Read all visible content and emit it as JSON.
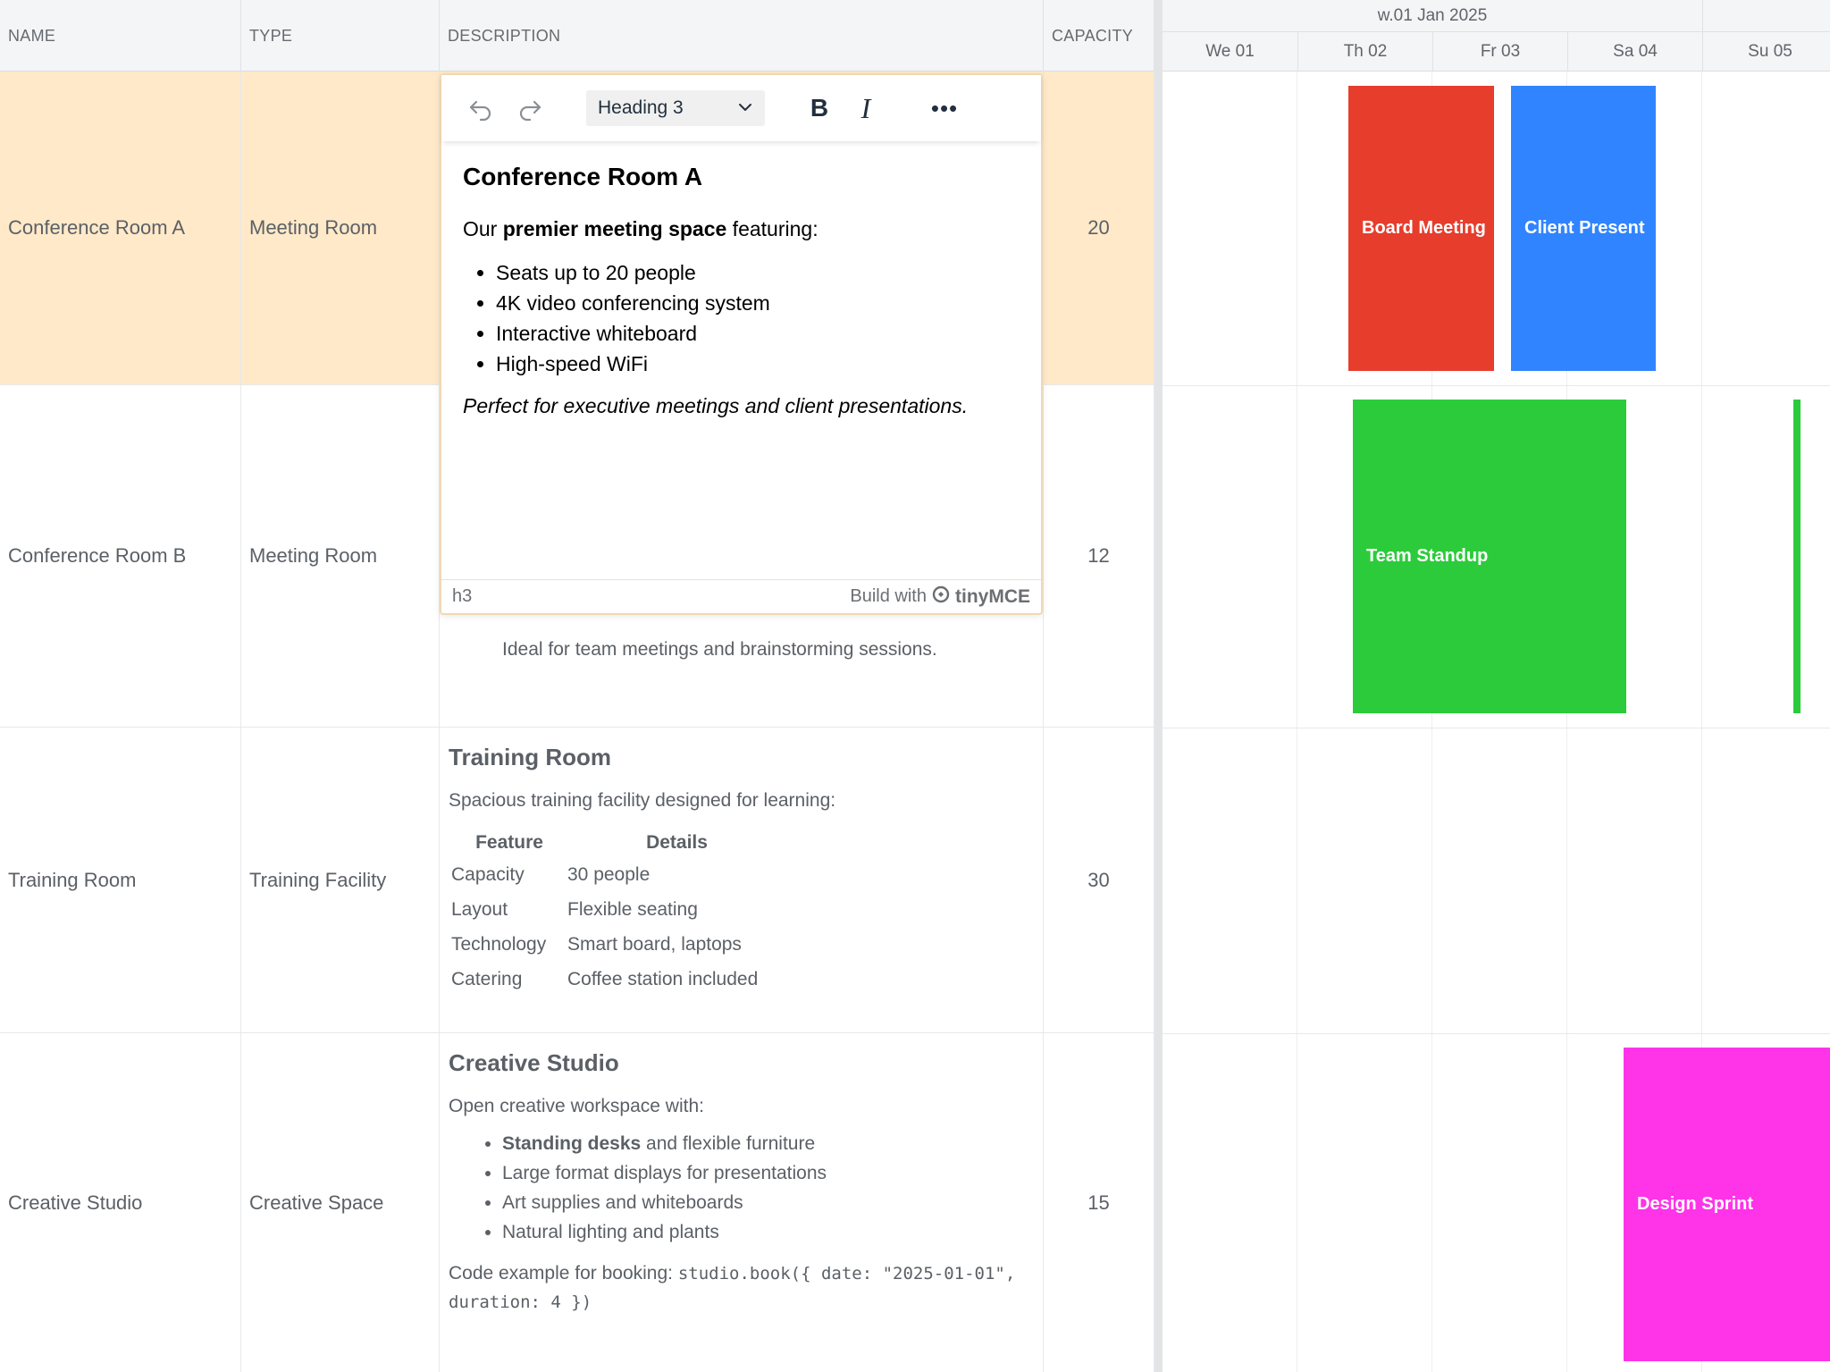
{
  "columns": {
    "name": "NAME",
    "type": "TYPE",
    "description": "DESCRIPTION",
    "capacity": "CAPACITY"
  },
  "timeline": {
    "week_label": "w.01 Jan 2025",
    "days": [
      "We 01",
      "Th 02",
      "Fr 03",
      "Sa 04",
      "Su 05"
    ]
  },
  "rows": [
    {
      "name": "Conference Room A",
      "type": "Meeting Room",
      "capacity": "20"
    },
    {
      "name": "Conference Room B",
      "type": "Meeting Room",
      "capacity": "12",
      "description_tail": "Ideal for team meetings and brainstorming sessions."
    },
    {
      "name": "Training Room",
      "type": "Training Facility",
      "capacity": "30",
      "desc_title": "Training Room",
      "desc_intro": "Spacious training facility designed for learning:",
      "table_headers": [
        "Feature",
        "Details"
      ],
      "table_rows": [
        [
          "Capacity",
          "30 people"
        ],
        [
          "Layout",
          "Flexible seating"
        ],
        [
          "Technology",
          "Smart board, laptops"
        ],
        [
          "Catering",
          "Coffee station included"
        ]
      ]
    },
    {
      "name": "Creative Studio",
      "type": "Creative Space",
      "capacity": "15",
      "desc_title": "Creative Studio",
      "desc_intro": "Open creative workspace with:",
      "list_first_bold": "Standing desks",
      "list_first_rest": " and flexible furniture",
      "list": [
        "Large format displays for presentations",
        "Art supplies and whiteboards",
        "Natural lighting and plants"
      ],
      "code_prefix": "Code example for booking: ",
      "code": "studio.book({ date: \"2025-01-01\", duration: 4 })"
    }
  ],
  "events": [
    {
      "label": "Board Meeting",
      "color": "#e63d2c"
    },
    {
      "label": "Client Present",
      "color": "#3084ff"
    },
    {
      "label": "Team Standup",
      "color": "#2ccb3b"
    },
    {
      "label": "",
      "color": "#2ccb3b"
    },
    {
      "label": "Design Sprint",
      "color": "#ff33e8"
    }
  ],
  "editor": {
    "format_label": "Heading 3",
    "heading": "Conference Room A",
    "para_pre": "Our ",
    "para_bold": "premier meeting space",
    "para_post": " featuring:",
    "bullets": [
      "Seats up to 20 people",
      "4K video conferencing system",
      "Interactive whiteboard",
      "High-speed WiFi"
    ],
    "italic_line": "Perfect for executive meetings and client presentations.",
    "status_path": "h3",
    "build_with": "Build with",
    "brand": "tinyMCE",
    "icons": [
      "undo-icon",
      "redo-icon",
      "chevron-down-icon",
      "bold-icon",
      "italic-icon",
      "more-icon",
      "tinymce-logo-icon"
    ]
  }
}
